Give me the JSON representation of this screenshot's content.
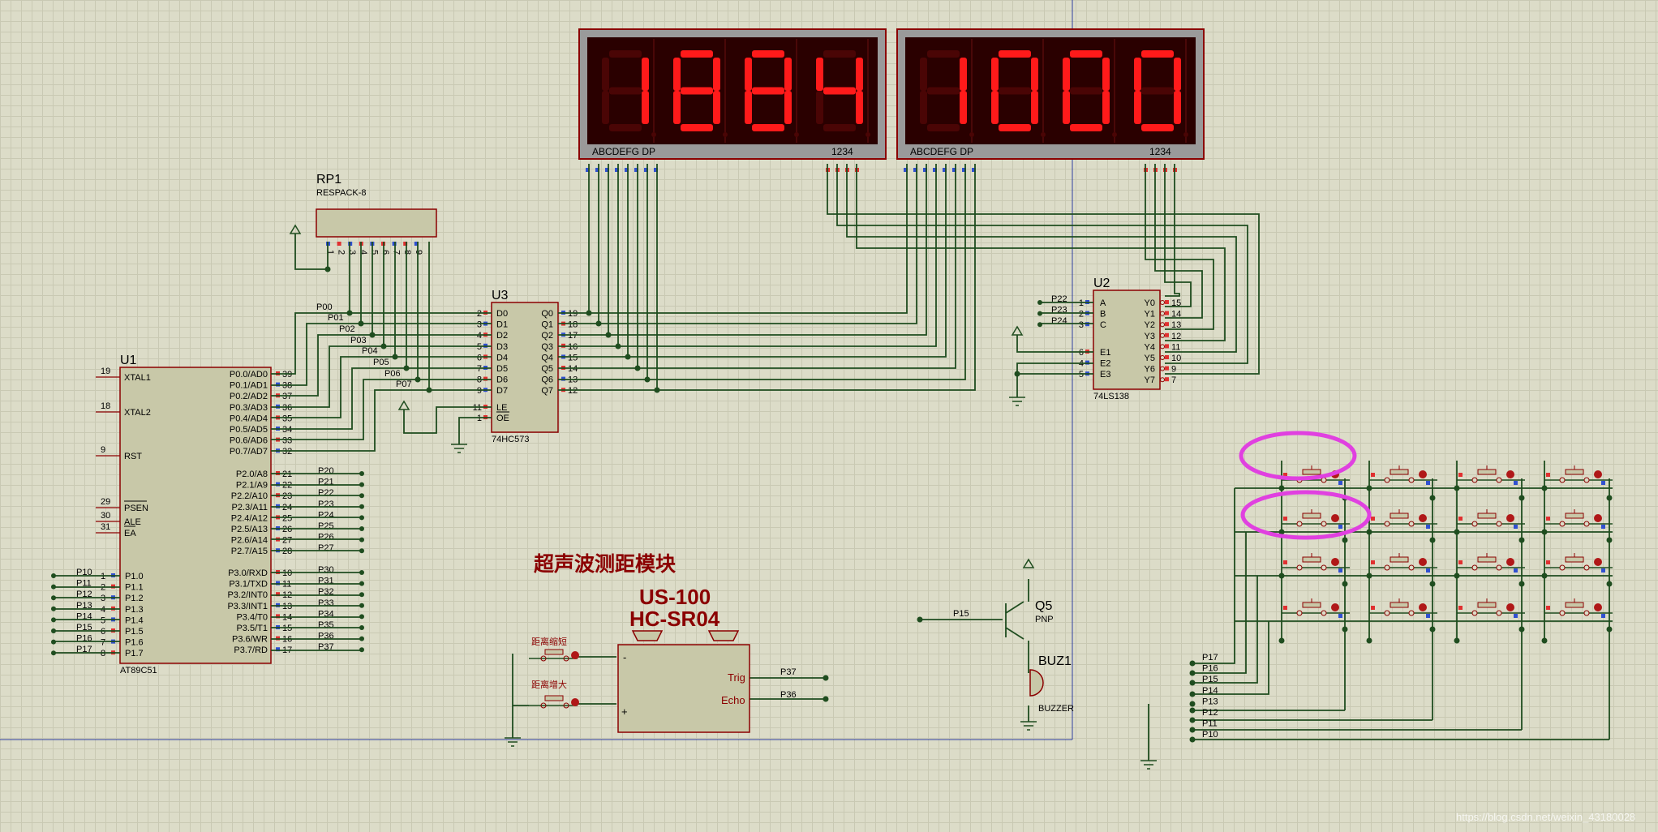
{
  "display_left": {
    "digits": [
      "1",
      "8",
      "8",
      "4"
    ],
    "seg_label": "ABCDEFG DP",
    "pin_label": "1234"
  },
  "display_right": {
    "digits": [
      "1",
      "0",
      "0",
      "0"
    ],
    "seg_label": "ABCDEFG DP",
    "pin_label": "1234"
  },
  "rp1": {
    "ref": "RP1",
    "type": "RESPACK-8",
    "pins": [
      "1",
      "2",
      "3",
      "4",
      "5",
      "6",
      "7",
      "8",
      "9"
    ]
  },
  "u1": {
    "ref": "U1",
    "type": "AT89C51",
    "left_pins": [
      {
        "num": "19",
        "name": "XTAL1"
      },
      {
        "num": "18",
        "name": "XTAL2"
      },
      {
        "num": "9",
        "name": "RST"
      },
      {
        "num": "29",
        "name": "PSEN"
      },
      {
        "num": "30",
        "name": "ALE"
      },
      {
        "num": "31",
        "name": "EA"
      }
    ],
    "p1_pins": [
      {
        "net": "P10",
        "num": "1",
        "name": "P1.0"
      },
      {
        "net": "P11",
        "num": "2",
        "name": "P1.1"
      },
      {
        "net": "P12",
        "num": "3",
        "name": "P1.2"
      },
      {
        "net": "P13",
        "num": "4",
        "name": "P1.3"
      },
      {
        "net": "P14",
        "num": "5",
        "name": "P1.4"
      },
      {
        "net": "P15",
        "num": "6",
        "name": "P1.5"
      },
      {
        "net": "P16",
        "num": "7",
        "name": "P1.6"
      },
      {
        "net": "P17",
        "num": "8",
        "name": "P1.7"
      }
    ],
    "p0_pins": [
      {
        "name": "P0.0/AD0",
        "num": "39"
      },
      {
        "name": "P0.1/AD1",
        "num": "38"
      },
      {
        "name": "P0.2/AD2",
        "num": "37"
      },
      {
        "name": "P0.3/AD3",
        "num": "36"
      },
      {
        "name": "P0.4/AD4",
        "num": "35"
      },
      {
        "name": "P0.5/AD5",
        "num": "34"
      },
      {
        "name": "P0.6/AD6",
        "num": "33"
      },
      {
        "name": "P0.7/AD7",
        "num": "32"
      }
    ],
    "p2_pins": [
      {
        "name": "P2.0/A8",
        "num": "21",
        "net": "P20"
      },
      {
        "name": "P2.1/A9",
        "num": "22",
        "net": "P21"
      },
      {
        "name": "P2.2/A10",
        "num": "23",
        "net": "P22"
      },
      {
        "name": "P2.3/A11",
        "num": "24",
        "net": "P23"
      },
      {
        "name": "P2.4/A12",
        "num": "25",
        "net": "P24"
      },
      {
        "name": "P2.5/A13",
        "num": "26",
        "net": "P25"
      },
      {
        "name": "P2.6/A14",
        "num": "27",
        "net": "P26"
      },
      {
        "name": "P2.7/A15",
        "num": "28",
        "net": "P27"
      }
    ],
    "p3_pins": [
      {
        "name": "P3.0/RXD",
        "num": "10",
        "net": "P30"
      },
      {
        "name": "P3.1/TXD",
        "num": "11",
        "net": "P31"
      },
      {
        "name": "P3.2/INT0",
        "num": "12",
        "net": "P32"
      },
      {
        "name": "P3.3/INT1",
        "num": "13",
        "net": "P33"
      },
      {
        "name": "P3.4/T0",
        "num": "14",
        "net": "P34"
      },
      {
        "name": "P3.5/T1",
        "num": "15",
        "net": "P35"
      },
      {
        "name": "P3.6/WR",
        "num": "16",
        "net": "P36"
      },
      {
        "name": "P3.7/RD",
        "num": "17",
        "net": "P37"
      }
    ]
  },
  "p0_nets": [
    "P00",
    "P01",
    "P02",
    "P03",
    "P04",
    "P05",
    "P06",
    "P07"
  ],
  "u3": {
    "ref": "U3",
    "type": "74HC573",
    "d_pins": [
      {
        "num": "2",
        "name": "D0"
      },
      {
        "num": "3",
        "name": "D1"
      },
      {
        "num": "4",
        "name": "D2"
      },
      {
        "num": "5",
        "name": "D3"
      },
      {
        "num": "6",
        "name": "D4"
      },
      {
        "num": "7",
        "name": "D5"
      },
      {
        "num": "8",
        "name": "D6"
      },
      {
        "num": "9",
        "name": "D7"
      }
    ],
    "q_pins": [
      {
        "num": "19",
        "name": "Q0"
      },
      {
        "num": "18",
        "name": "Q1"
      },
      {
        "num": "17",
        "name": "Q2"
      },
      {
        "num": "16",
        "name": "Q3"
      },
      {
        "num": "15",
        "name": "Q4"
      },
      {
        "num": "14",
        "name": "Q5"
      },
      {
        "num": "13",
        "name": "Q6"
      },
      {
        "num": "12",
        "name": "Q7"
      }
    ],
    "ctrl_pins": [
      {
        "num": "11",
        "name": "LE"
      },
      {
        "num": "1",
        "name": "OE"
      }
    ]
  },
  "u2": {
    "ref": "U2",
    "type": "74LS138",
    "in_pins": [
      {
        "net": "P22",
        "num": "1",
        "name": "A"
      },
      {
        "net": "P23",
        "num": "2",
        "name": "B"
      },
      {
        "net": "P24",
        "num": "3",
        "name": "C"
      }
    ],
    "en_pins": [
      {
        "num": "6",
        "name": "E1"
      },
      {
        "num": "4",
        "name": "E2"
      },
      {
        "num": "5",
        "name": "E3"
      }
    ],
    "out_pins": [
      {
        "name": "Y0",
        "num": "15"
      },
      {
        "name": "Y1",
        "num": "14"
      },
      {
        "name": "Y2",
        "num": "13"
      },
      {
        "name": "Y3",
        "num": "12"
      },
      {
        "name": "Y4",
        "num": "11"
      },
      {
        "name": "Y5",
        "num": "10"
      },
      {
        "name": "Y6",
        "num": "9"
      },
      {
        "name": "Y7",
        "num": "7"
      }
    ]
  },
  "module": {
    "title_cn": "超声波测距模块",
    "model1": "US-100",
    "model2": "HC-SR04",
    "pin_trig": "Trig",
    "pin_echo": "Echo",
    "net_trig": "P37",
    "net_echo": "P36",
    "minus": "-",
    "plus": "+",
    "btn_short": "距离缩短",
    "btn_long": "距离增大"
  },
  "q5": {
    "ref": "Q5",
    "type": "PNP",
    "net": "P15"
  },
  "buz1": {
    "ref": "BUZ1",
    "type": "BUZZER"
  },
  "keypad_nets": [
    "P17",
    "P16",
    "P15",
    "P14",
    "P13",
    "P12",
    "P11",
    "P10"
  ],
  "watermark": "https://blog.csdn.net/weixin_43180028"
}
